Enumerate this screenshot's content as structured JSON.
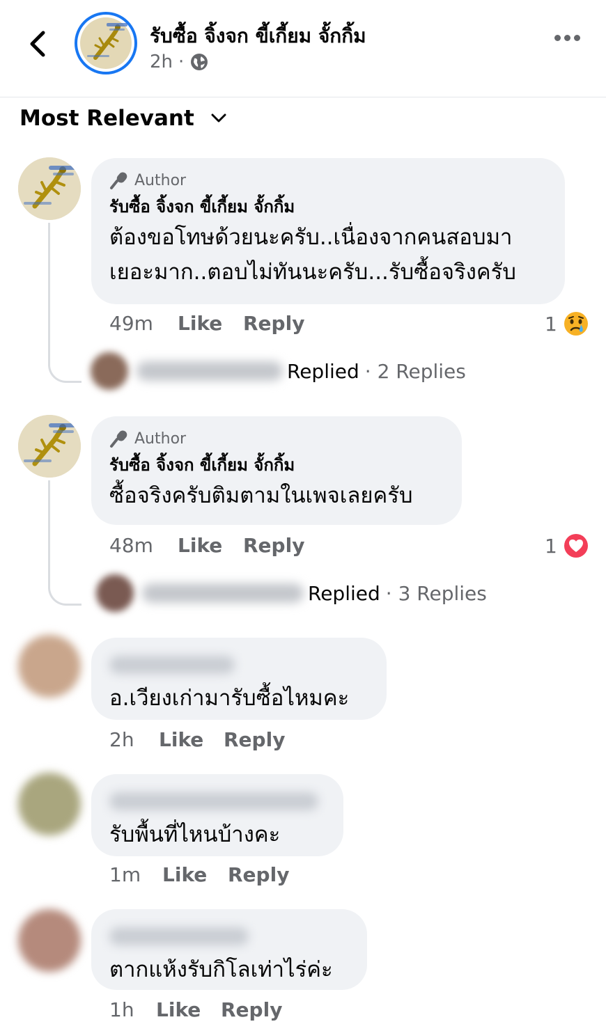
{
  "header": {
    "page_name": "รับซื้อ จิ้งจก ขี้เกี้ยม จั้กกิ้ม",
    "time": "2h",
    "separator": "·",
    "back_icon": "chevron-left-icon",
    "privacy_icon": "globe-icon",
    "more_icon": "more-horizontal-icon"
  },
  "sort": {
    "label": "Most Relevant",
    "icon": "chevron-down-icon"
  },
  "colors": {
    "accent": "#1877f2",
    "bubble": "#f0f2f5",
    "secondary_text": "#65676b",
    "love": "#f33e58",
    "sad": "#f7b125"
  },
  "comments": [
    {
      "badge": "Author",
      "name": "รับซื้อ จิ้งจก ขี้เกี้ยม จั้กกิ้ม",
      "text_line1": "ต้องขอโทษด้วยนะครับ..เนื่องจากคนสอบมา",
      "text_line2": "เยอะมาก..ตอบไม่ทันนะครับ...รับซื้อจริงครับ",
      "time": "49m",
      "like": "Like",
      "reply": "Reply",
      "reaction_count": "1",
      "reaction_icon": "sad-reaction-icon",
      "replied_label": "Replied",
      "replies": "· 2 Replies"
    },
    {
      "badge": "Author",
      "name": "รับซื้อ จิ้งจก ขี้เกี้ยม จั้กกิ้ม",
      "text_line1": "ซื้อจริงครับติมตามในเพจเลยครับ",
      "time": "48m",
      "like": "Like",
      "reply": "Reply",
      "reaction_count": "1",
      "reaction_icon": "love-reaction-icon",
      "replied_label": "Replied",
      "replies": "· 3 Replies"
    },
    {
      "text": "อ.เวียงเก่ามารับซื้อไหมคะ",
      "time": "2h",
      "like": "Like",
      "reply": "Reply"
    },
    {
      "text": "รับพื้นที่ไหนบ้างคะ",
      "time": "1m",
      "like": "Like",
      "reply": "Reply"
    },
    {
      "text": "ตากแห้งรับกิโลเท่าไร่ค่ะ",
      "time": "1h",
      "like": "Like",
      "reply": "Reply"
    }
  ]
}
